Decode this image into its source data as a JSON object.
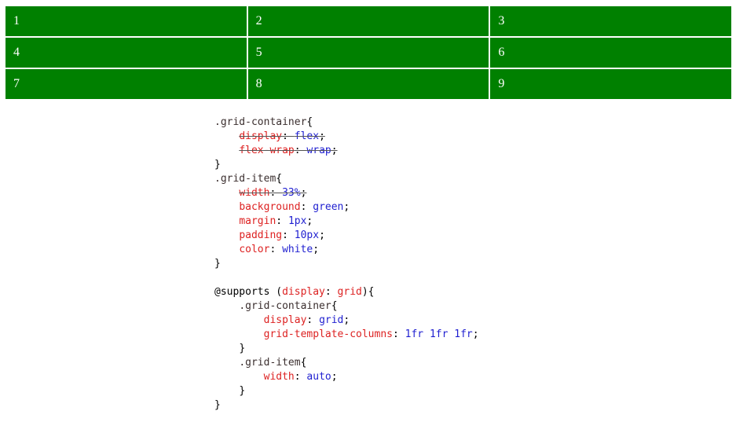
{
  "page": {
    "background": "#ffffff",
    "item_background": "#008000",
    "item_color": "#ffffff",
    "selector_color": "#3b2f2f",
    "property_color": "#dd2222",
    "value_color": "#1f1fd0",
    "strike_color": "#555555"
  },
  "grid": {
    "columns": 3,
    "items": [
      {
        "label": "1"
      },
      {
        "label": "2"
      },
      {
        "label": "3"
      },
      {
        "label": "4"
      },
      {
        "label": "5"
      },
      {
        "label": "6"
      },
      {
        "label": "7"
      },
      {
        "label": "8"
      },
      {
        "label": "9"
      }
    ]
  },
  "code": {
    "lines": [
      {
        "indent": 0,
        "tokens": [
          {
            "t": ".grid-container",
            "k": "sel"
          },
          {
            "t": "{",
            "k": "punct"
          }
        ]
      },
      {
        "indent": 1,
        "struck": true,
        "tokens": [
          {
            "t": "display",
            "k": "prop"
          },
          {
            "t": ": ",
            "k": "punct"
          },
          {
            "t": "flex",
            "k": "val"
          },
          {
            "t": ";",
            "k": "punct"
          }
        ]
      },
      {
        "indent": 1,
        "struck": true,
        "tokens": [
          {
            "t": "flex-wrap",
            "k": "prop"
          },
          {
            "t": ": ",
            "k": "punct"
          },
          {
            "t": "wrap",
            "k": "val"
          },
          {
            "t": ";",
            "k": "punct"
          }
        ]
      },
      {
        "indent": 0,
        "tokens": [
          {
            "t": "}",
            "k": "punct"
          }
        ]
      },
      {
        "indent": 0,
        "tokens": [
          {
            "t": ".grid-item",
            "k": "sel"
          },
          {
            "t": "{",
            "k": "punct"
          }
        ]
      },
      {
        "indent": 1,
        "struck": true,
        "tokens": [
          {
            "t": "width",
            "k": "prop"
          },
          {
            "t": ": ",
            "k": "punct"
          },
          {
            "t": "33%",
            "k": "val"
          },
          {
            "t": ";",
            "k": "punct"
          }
        ]
      },
      {
        "indent": 1,
        "tokens": [
          {
            "t": "background",
            "k": "prop"
          },
          {
            "t": ": ",
            "k": "punct"
          },
          {
            "t": "green",
            "k": "val"
          },
          {
            "t": ";",
            "k": "punct"
          }
        ]
      },
      {
        "indent": 1,
        "tokens": [
          {
            "t": "margin",
            "k": "prop"
          },
          {
            "t": ": ",
            "k": "punct"
          },
          {
            "t": "1px",
            "k": "val"
          },
          {
            "t": ";",
            "k": "punct"
          }
        ]
      },
      {
        "indent": 1,
        "tokens": [
          {
            "t": "padding",
            "k": "prop"
          },
          {
            "t": ": ",
            "k": "punct"
          },
          {
            "t": "10px",
            "k": "val"
          },
          {
            "t": ";",
            "k": "punct"
          }
        ]
      },
      {
        "indent": 1,
        "tokens": [
          {
            "t": "color",
            "k": "prop"
          },
          {
            "t": ": ",
            "k": "punct"
          },
          {
            "t": "white",
            "k": "val"
          },
          {
            "t": ";",
            "k": "punct"
          }
        ]
      },
      {
        "indent": 0,
        "tokens": [
          {
            "t": "}",
            "k": "punct"
          }
        ]
      },
      {
        "indent": 0,
        "tokens": []
      },
      {
        "indent": 0,
        "tokens": [
          {
            "t": "@supports (",
            "k": "punct"
          },
          {
            "t": "display",
            "k": "prop"
          },
          {
            "t": ": ",
            "k": "punct"
          },
          {
            "t": "grid",
            "k": "prop"
          },
          {
            "t": "){",
            "k": "punct"
          }
        ]
      },
      {
        "indent": 1,
        "tokens": [
          {
            "t": ".grid-container",
            "k": "sel"
          },
          {
            "t": "{",
            "k": "punct"
          }
        ]
      },
      {
        "indent": 2,
        "tokens": [
          {
            "t": "display",
            "k": "prop"
          },
          {
            "t": ": ",
            "k": "punct"
          },
          {
            "t": "grid",
            "k": "val"
          },
          {
            "t": ";",
            "k": "punct"
          }
        ]
      },
      {
        "indent": 2,
        "tokens": [
          {
            "t": "grid-template-columns",
            "k": "prop"
          },
          {
            "t": ": ",
            "k": "punct"
          },
          {
            "t": "1fr 1fr 1fr",
            "k": "val"
          },
          {
            "t": ";",
            "k": "punct"
          }
        ]
      },
      {
        "indent": 1,
        "tokens": [
          {
            "t": "}",
            "k": "punct"
          }
        ]
      },
      {
        "indent": 1,
        "tokens": [
          {
            "t": ".grid-item",
            "k": "sel"
          },
          {
            "t": "{",
            "k": "punct"
          }
        ]
      },
      {
        "indent": 2,
        "tokens": [
          {
            "t": "width",
            "k": "prop"
          },
          {
            "t": ": ",
            "k": "punct"
          },
          {
            "t": "auto",
            "k": "val"
          },
          {
            "t": ";",
            "k": "punct"
          }
        ]
      },
      {
        "indent": 1,
        "tokens": [
          {
            "t": "}",
            "k": "punct"
          }
        ]
      },
      {
        "indent": 0,
        "tokens": [
          {
            "t": "}",
            "k": "punct"
          }
        ]
      }
    ]
  }
}
